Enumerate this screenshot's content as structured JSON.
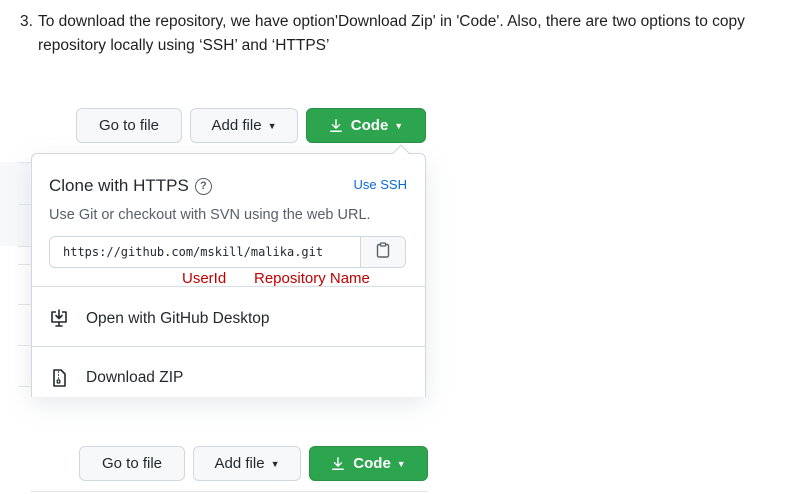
{
  "instruction": {
    "number": "3.",
    "text": "To download the repository, we have option'Download Zip' in 'Code'. Also, there are two options to copy repository locally using ‘SSH’ and ‘HTTPS’"
  },
  "toolbar_top": {
    "go_to_file": "Go to file",
    "add_file": "Add file",
    "code": "Code"
  },
  "dropdown": {
    "title": "Clone with HTTPS",
    "use_ssh": "Use SSH",
    "description": "Use Git or checkout with SVN using the web URL.",
    "url": "https://github.com/mskill/malika.git",
    "annotation_userid": "UserId",
    "annotation_repo": "Repository Name",
    "open_desktop": "Open with GitHub Desktop",
    "download_zip": "Download ZIP"
  },
  "toolbar_bottom": {
    "go_to_file": "Go to file",
    "add_file": "Add file",
    "code": "Code"
  },
  "colors": {
    "code_button": "#2da44e",
    "link": "#0969da",
    "annotation": "#c00000"
  }
}
